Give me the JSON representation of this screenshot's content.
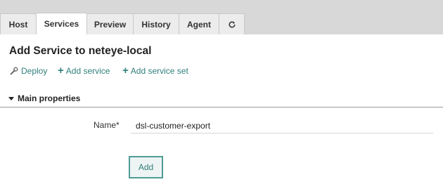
{
  "tabs": {
    "host": "Host",
    "services": "Services",
    "preview": "Preview",
    "history": "History",
    "agent": "Agent",
    "refresh_icon": "refresh-icon",
    "active": "Services"
  },
  "page": {
    "title": "Add Service to neteye-local"
  },
  "actions": {
    "deploy": "Deploy",
    "add_service": "Add service",
    "add_service_set": "Add service set"
  },
  "section": {
    "title": "Main properties",
    "expanded": "expanded"
  },
  "form": {
    "name_label": "Name*",
    "name_value": "dsl-customer-export"
  },
  "buttons": {
    "add": "Add"
  },
  "colors": {
    "accent": "#2f7f7a",
    "tabbar_bg": "#d8d8d8"
  }
}
